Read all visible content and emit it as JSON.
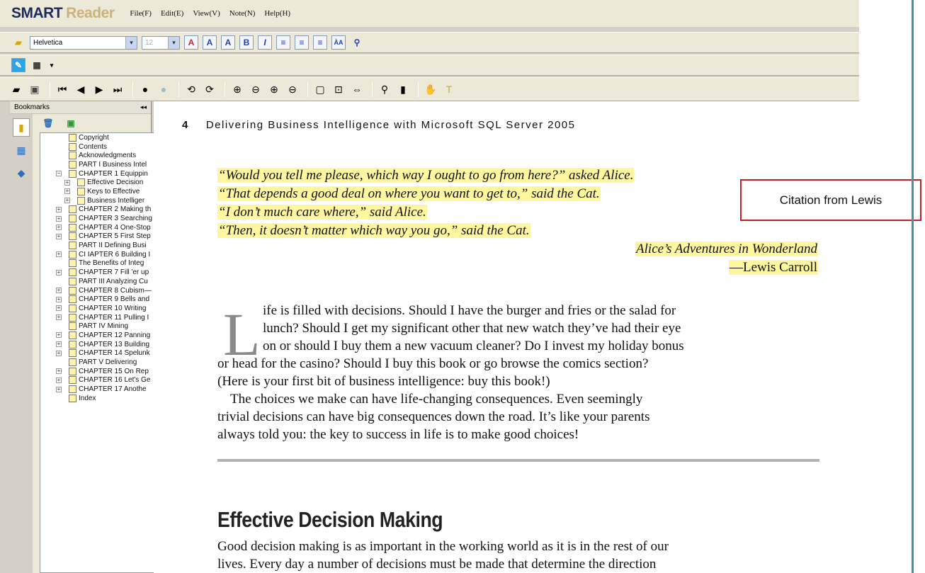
{
  "app": {
    "brand_a": "SMART",
    "brand_b": "Reader"
  },
  "menu": [
    "File(F)",
    "Edit(E)",
    "View(V)",
    "Note(N)",
    "Help(H)"
  ],
  "format_toolbar": {
    "font": "Helvetica",
    "size": "12"
  },
  "sidebar": {
    "title": "Bookmarks",
    "collapse": "◂◂",
    "items": [
      "Copyright",
      "Contents",
      "Acknowledgments",
      "PART I Business Intel",
      "CHAPTER 1 Equippin",
      "Effective Decision",
      "Keys to Effective",
      "Business Intelliger",
      "CHAPTER 2 Making th",
      "CHAPTER 3 Searching",
      "CHAPTER 4 One-Stop",
      "CHAPTER 5 First Step",
      "PART II Defining Busi",
      "CI IAPTER 6 Building I",
      "The Benefits of Integ",
      "CHAPTER 7 Fill 'er up",
      "PART III Analyzing Cu",
      "CHAPTER 8 Cubism—",
      "CHAPTER 9 Bells and",
      "CHAPTER 10 Writing",
      "CHAPTER 11 Pulling I",
      "PART IV Mining",
      "CHAPTER 12 Panning",
      "CHAPTER 13 Building",
      "CHAPTER 14 Spelunk",
      "PART V Delivering",
      "CHAPTER 15 On Rep",
      "CHAPTER 16 Let's Ge",
      "CHAPTER 17 Anothe",
      "Index"
    ]
  },
  "page": {
    "number": "4",
    "running_title": "Delivering Business Intelligence with Microsoft SQL Server 2005",
    "quote": [
      "“Would you tell me please, which way I ought to go from here?” asked Alice.",
      "“That depends a good deal on where you want to get to,” said the Cat.",
      "“I don’t much care where,” said Alice.",
      "“Then, it doesn’t matter which way you go,” said the Cat."
    ],
    "quote_source": "Alice’s Adventures in Wonderland",
    "quote_author": "—Lewis Carroll",
    "drop_cap": "L",
    "para1": [
      "ife is filled with decisions. Should I have the burger and fries or the salad for",
      "lunch? Should I get my significant other that new watch they’ve had their eye",
      "on or should I buy them a new vacuum cleaner? Do I invest my holiday bonus",
      "or head for the casino? Should I buy this book or go browse the comics section?",
      "(Here is your first bit of business intelligence: buy this book!)"
    ],
    "para2": [
      "The choices we make can have life-changing consequences. Even seemingly",
      "trivial decisions can have big consequences down the road. It’s like your parents",
      "always told you: the key to success in life is to make good choices!"
    ],
    "section_heading": "Effective Decision Making",
    "para3": [
      "Good decision making is as important in the working world as it is in the rest of our",
      "lives. Every day a number of decisions must be made that determine the direction"
    ]
  },
  "callout": "Citation from Lewis"
}
